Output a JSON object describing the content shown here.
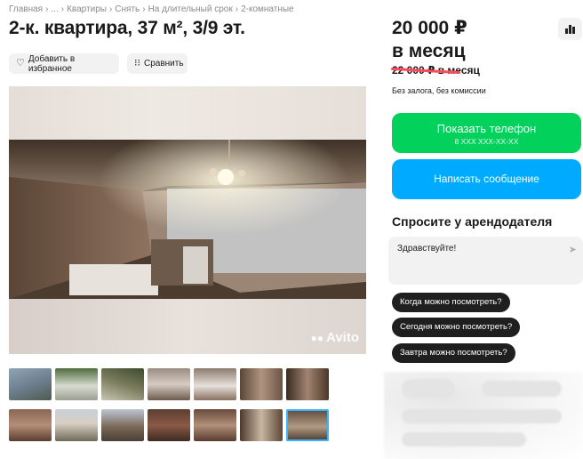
{
  "breadcrumbs": [
    "Главная",
    "...",
    "Квартиры",
    "Снять",
    "На длительный срок",
    "2-комнатные"
  ],
  "breadcrumb_separator": "›",
  "title": "2-к. квартира, 37 м², 3/9 эт.",
  "actions": {
    "favorite_label": "Добавить в избранное",
    "compare_label": "Сравнить"
  },
  "gallery": {
    "watermark": "Avito",
    "thumbnail_count_row1": 7,
    "thumbnail_count_row2": 7
  },
  "price": {
    "current_line1": "20 000 ₽",
    "current_line2": "в месяц",
    "old": "22 000 ₽ в месяц",
    "terms": "Без залога, без комиссии"
  },
  "buttons": {
    "phone_label": "Показать телефон",
    "phone_mask": "8 XXX XXX-XX-XX",
    "message_label": "Написать сообщение"
  },
  "ask": {
    "title": "Спросите у арендодателя",
    "message_value": "Здравствуйте!",
    "quick_questions": [
      "Когда можно посмотреть?",
      "Сегодня можно посмотреть?",
      "Завтра можно посмотреть?"
    ]
  },
  "colors": {
    "phone_button": "#02d15c",
    "message_button": "#00aaff",
    "strike": "#ff4a5a",
    "selected_thumb": "#3ab4ff"
  },
  "icons": {
    "favorite": "heart-icon",
    "compare": "compare-icon",
    "stats": "bar-chart-icon",
    "send": "send-icon"
  }
}
